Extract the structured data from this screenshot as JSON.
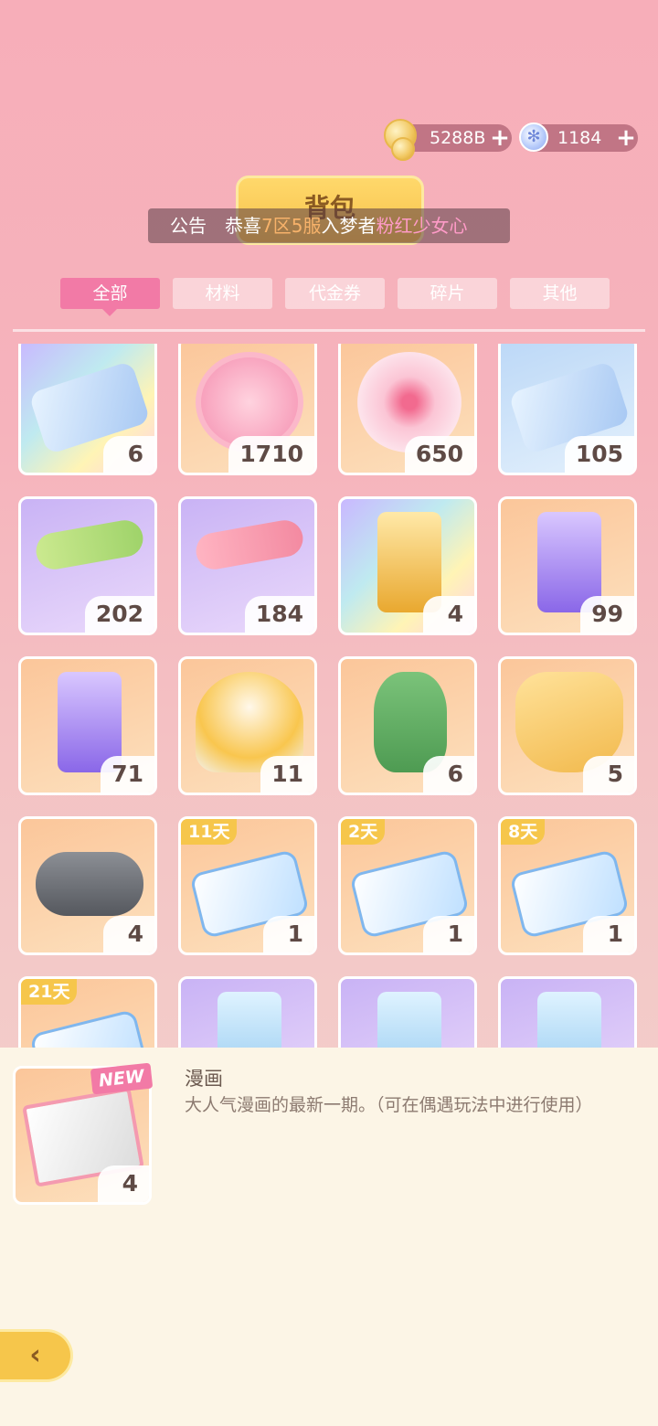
{
  "currencies": {
    "coins": "5288B",
    "gems": "1184",
    "plus": "+",
    "coin_icon": "coin-stack-icon",
    "gem_icon": "snowflake-gem-icon"
  },
  "title": "背包",
  "notice": {
    "label": "公告",
    "text_1": "恭喜",
    "highlight_server": "7区5服",
    "text_2": "入梦者",
    "highlight_name": "粉红少女心"
  },
  "tabs": [
    {
      "label": "全部",
      "active": true
    },
    {
      "label": "材料",
      "active": false
    },
    {
      "label": "代金券",
      "active": false
    },
    {
      "label": "碎片",
      "active": false
    },
    {
      "label": "其他",
      "active": false
    }
  ],
  "items": [
    {
      "icon": "mystery-ticket-icon",
      "count": "6"
    },
    {
      "icon": "pink-bag-badge-icon",
      "count": "1710"
    },
    {
      "icon": "sakura-flower-icon",
      "count": "650"
    },
    {
      "icon": "blue-ticket-icon",
      "count": "105"
    },
    {
      "icon": "green-paint-roller-icon",
      "count": "202"
    },
    {
      "icon": "pink-paint-roller-icon",
      "count": "184"
    },
    {
      "icon": "golden-hourglass-icon",
      "count": "4"
    },
    {
      "icon": "purple-hourglass-icon",
      "count": "99"
    },
    {
      "icon": "purple-hourglass-icon",
      "count": "71"
    },
    {
      "icon": "mango-parfait-icon",
      "count": "11"
    },
    {
      "icon": "green-dinosaur-icon",
      "count": "6"
    },
    {
      "icon": "bunny-pouch-icon",
      "count": "5"
    },
    {
      "icon": "game-controller-icon",
      "count": "4"
    },
    {
      "icon": "sale-coupon-icon",
      "count": "1",
      "days": "11天"
    },
    {
      "icon": "sale-coupon-icon",
      "count": "1",
      "days": "2天"
    },
    {
      "icon": "sale-coupon-icon",
      "count": "1",
      "days": "8天"
    },
    {
      "icon": "sale-coupon-icon",
      "count": "",
      "days": "21天"
    },
    {
      "icon": "aqua-hourglass-icon",
      "count": ""
    },
    {
      "icon": "aqua-hourglass-icon",
      "count": ""
    },
    {
      "icon": "aqua-hourglass-icon",
      "count": ""
    }
  ],
  "detail": {
    "new_tag": "NEW",
    "name": "漫画",
    "description": "大人气漫画的最新一期。（可在偶遇玩法中进行使用）",
    "count": "4",
    "icon": "manga-book-icon"
  },
  "back_icon": "back-arrow-icon",
  "colors": {
    "accent_pink": "#f27aa6",
    "gold": "#f6c64b",
    "orange_highlight": "#f7b26a",
    "pink_highlight": "#ff9bc8"
  }
}
